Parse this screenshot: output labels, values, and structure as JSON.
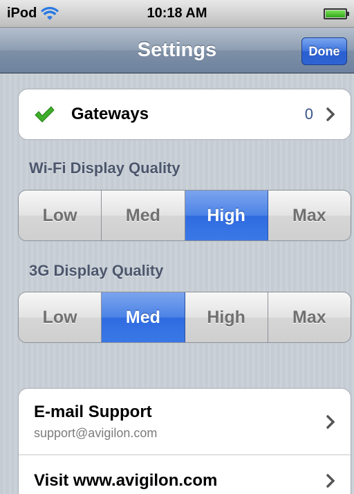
{
  "status_bar": {
    "device": "iPod",
    "time": "10:18 AM",
    "wifi_icon": "wifi-icon",
    "battery_icon": "battery-icon"
  },
  "nav": {
    "title": "Settings",
    "done_label": "Done"
  },
  "gateways": {
    "icon": "checkmark-icon",
    "label": "Gateways",
    "count": "0"
  },
  "wifi_quality": {
    "label": "Wi-Fi Display Quality",
    "options": [
      "Low",
      "Med",
      "High",
      "Max"
    ],
    "selected": "High"
  },
  "cellular_quality": {
    "label": "3G Display Quality",
    "options": [
      "Low",
      "Med",
      "High",
      "Max"
    ],
    "selected": "Med"
  },
  "support": {
    "email_title": "E-mail Support",
    "email_address": "support@avigilon.com",
    "visit_label": "Visit www.avigilon.com"
  },
  "colors": {
    "accent_blue": "#2f6be0",
    "check_green": "#3fae2a",
    "value_blue": "#385487"
  }
}
